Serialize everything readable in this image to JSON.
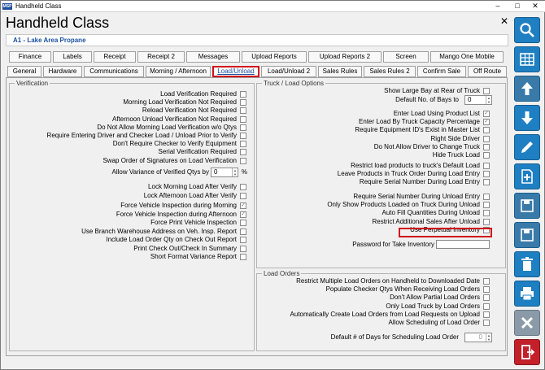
{
  "window": {
    "title": "Handheld Class",
    "minimize": "–",
    "maximize": "□",
    "close": "✕"
  },
  "heading": "Handheld Class",
  "company": "A1 - Lake Area Propane",
  "tabs_row1": [
    "Finance",
    "Labels",
    "Receipt",
    "Receipt 2",
    "Messages",
    "Upload Reports",
    "Upload Reports 2",
    "Screen",
    "Mango One Mobile"
  ],
  "tabs_row2": [
    "General",
    "Hardware",
    "Communications",
    "Morning / Afternoon",
    "Load/Unload",
    "Load/Unload 2",
    "Sales Rules",
    "Sales Rules 2",
    "Confirm Sale",
    "Off Route"
  ],
  "active_tab": "Load/Unload",
  "verification": {
    "title": "Verification",
    "items": [
      {
        "label": "Load Verification Required",
        "checked": false
      },
      {
        "label": "Morning Load Verification Not Required",
        "checked": false
      },
      {
        "label": "Reload Verification Not Required",
        "checked": false
      },
      {
        "label": "Afternoon Unload Verification Not Required",
        "checked": false
      },
      {
        "label": "Do Not Allow Morning Load Verification w/o Qtys",
        "checked": false
      },
      {
        "label": "Require Entering Driver and Checker Load / Unload Prior to Verify",
        "checked": false
      },
      {
        "label": "Don't Require Checker to Verify Equipment",
        "checked": false
      },
      {
        "label": "Serial Verification Required",
        "checked": false
      },
      {
        "label": "Swap Order of Signatures on Load Verification",
        "checked": false
      }
    ],
    "variance_label": "Allow Variance of Verified Qtys by",
    "variance_value": "0",
    "variance_unit": "%",
    "items2": [
      {
        "label": "Lock Morning Load After Verify",
        "checked": false
      },
      {
        "label": "Lock Afternoon Load After Verify",
        "checked": false
      }
    ],
    "items3": [
      {
        "label": "Force Vehicle Inspection during Morning",
        "checked": true
      },
      {
        "label": "Force Vehicle Inspection during Afternoon",
        "checked": true
      },
      {
        "label": "Force Print Vehicle Inspection",
        "checked": false
      },
      {
        "label": "Use Branch Warehouse Address on Veh. Insp. Report",
        "checked": false
      },
      {
        "label": "Include Load Order Qty on Check Out Report",
        "checked": false
      },
      {
        "label": "Print Check Out/Check In Summary",
        "checked": false
      },
      {
        "label": "Short Format Variance Report",
        "checked": false
      }
    ]
  },
  "truck": {
    "title": "Truck / Load Options",
    "bay_label": "Show Large Bay at Rear of Truck",
    "bay_checked": false,
    "default_bays_label": "Default No. of Bays to",
    "default_bays_value": "0",
    "items": [
      {
        "label": "Enter Load Using Product List",
        "checked": true
      },
      {
        "label": "Enter Load By Truck Capacity Percentage",
        "checked": true
      },
      {
        "label": "Require Equipment ID's Exist in Master List",
        "checked": false
      },
      {
        "label": "Right Side Driver",
        "checked": false
      },
      {
        "label": "Do Not Allow Driver to Change Truck",
        "checked": false
      },
      {
        "label": "Hide Truck Load",
        "checked": false
      }
    ],
    "items2": [
      {
        "label": "Restrict load products to truck's Default Load",
        "checked": false
      },
      {
        "label": "Leave Products in Truck Order During Load Entry",
        "checked": false
      },
      {
        "label": "Require Serial Number During Load Entry",
        "checked": false
      }
    ],
    "items3": [
      {
        "label": "Require Serial Number During Unload Entry",
        "checked": false
      },
      {
        "label": "Only Show Products Loaded on Truck During Unload",
        "checked": false
      },
      {
        "label": "Auto Fill Quantities During Unload",
        "checked": false
      },
      {
        "label": "Restrict Additional Sales After Unload",
        "checked": false
      },
      {
        "label": "Use Perpetual Inventory",
        "checked": false
      }
    ],
    "password_label": "Password for Take Inventory",
    "password_value": ""
  },
  "load_orders": {
    "title": "Load Orders",
    "items": [
      {
        "label": "Restrict Multiple Load Orders on Handheld to Downloaded Date",
        "checked": false
      },
      {
        "label": "Populate Checker Qtys When Receiving Load Orders",
        "checked": false
      },
      {
        "label": "Don't Allow Partial Load Orders",
        "checked": false
      },
      {
        "label": "Only Load Truck by Load Orders",
        "checked": false
      },
      {
        "label": "Automatically Create Load Orders from Load Requests on Upload",
        "checked": false
      },
      {
        "label": "Allow Scheduling of Load Order",
        "checked": false
      }
    ],
    "days_label": "Default # of Days for Scheduling Load Order",
    "days_value": "0"
  },
  "sidebar": [
    "search-icon",
    "grid-icon",
    "arrow-up-icon",
    "arrow-down-icon",
    "edit-icon",
    "new-document-icon",
    "save-copy-icon",
    "save-icon",
    "delete-icon",
    "print-icon",
    "cancel-icon",
    "exit-icon"
  ]
}
